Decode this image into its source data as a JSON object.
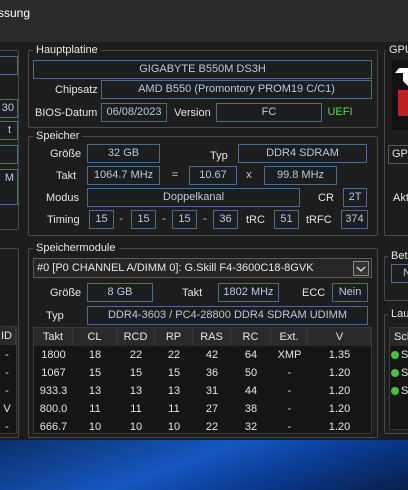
{
  "window": {
    "title_fragment": "ssung"
  },
  "mainboard": {
    "legend": "Hauptplatine",
    "model": "GIGABYTE B550M DS3H",
    "chipset_label": "Chipsatz",
    "chipset": "AMD B550 (Promontory PROM19 C/C1)",
    "bios_date_label": "BIOS-Datum",
    "bios_date": "06/08/2023",
    "version_label": "Version",
    "version": "FC",
    "uefi": "UEFI"
  },
  "memory": {
    "legend": "Speicher",
    "size_label": "Größe",
    "size": "32 GB",
    "type_label": "Typ",
    "type": "DDR4 SDRAM",
    "clock_label": "Takt",
    "clock": "1064.7 MHz",
    "equals": "=",
    "multiplier": "10.67",
    "times": "x",
    "base_clock": "99.8 MHz",
    "mode_label": "Modus",
    "mode": "Doppelkanal",
    "cr_label": "CR",
    "cr": "2T",
    "timing_label": "Timing",
    "t1": "15",
    "t2": "15",
    "t3": "15",
    "t4": "36",
    "dash": "-",
    "trc_label": "tRC",
    "trc": "51",
    "trfc_label": "tRFC",
    "trfc": "374"
  },
  "modules": {
    "legend": "Speichermodule",
    "selected": "#0 [P0 CHANNEL A/DIMM 0]: G.Skill F4-3600C18-8GVK",
    "size_label": "Größe",
    "size": "8 GB",
    "clock_label": "Takt",
    "clock": "1802 MHz",
    "ecc_label": "ECC",
    "ecc": "Nein",
    "type_label": "Typ",
    "type": "DDR4-3603 / PC4-28800 DDR4 SDRAM UDIMM",
    "headers": [
      "Takt",
      "CL",
      "RCD",
      "RP",
      "RAS",
      "RC",
      "Ext.",
      "V"
    ],
    "rows": [
      [
        "1800",
        "18",
        "22",
        "22",
        "42",
        "64",
        "XMP",
        "1.35"
      ],
      [
        "1067",
        "15",
        "15",
        "15",
        "36",
        "50",
        "-",
        "1.20"
      ],
      [
        "933.3",
        "13",
        "13",
        "13",
        "31",
        "44",
        "-",
        "1.20"
      ],
      [
        "800.0",
        "11",
        "11",
        "11",
        "27",
        "38",
        "-",
        "1.20"
      ],
      [
        "666.7",
        "10",
        "10",
        "10",
        "22",
        "32",
        "-",
        "1.20"
      ]
    ]
  },
  "left_partial": {
    "values": [
      "30",
      "t",
      "M"
    ],
    "table_header": "ID",
    "rows": [
      "-",
      "-",
      "-",
      "V",
      "-"
    ]
  },
  "right_partial": {
    "gpu_legend": "GPU",
    "gpu_field": "GPU",
    "akt_label": "Akt",
    "betr_legend": "Betr",
    "betr_value": "N",
    "lauf_legend": "Lauf",
    "sch_header": "Sch",
    "items": [
      "S",
      "S",
      "S"
    ]
  },
  "colors": {
    "background": "#1d1d1d",
    "value_text": "#b8cbe0",
    "value_border": "#4f6a86",
    "uefi_green": "#5fd45f",
    "status_green": "#46c146",
    "amd_red": "#c0211f"
  },
  "icons": {
    "dropdown": "chevron-down-icon",
    "logo": "amd-logo"
  }
}
